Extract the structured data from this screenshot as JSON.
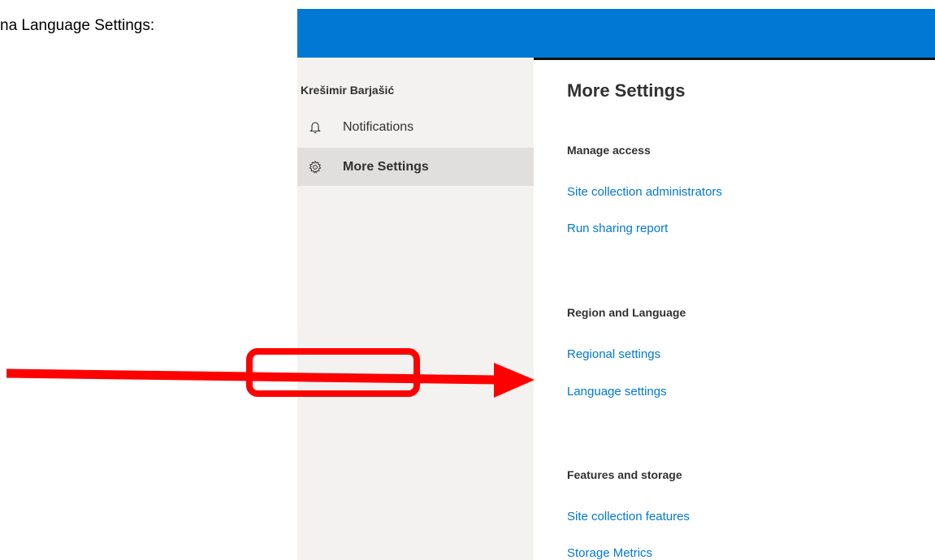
{
  "caption": "na Language Settings:",
  "sidebar": {
    "user_name": "Krešimir Barjašić",
    "items": [
      {
        "label": "Notifications",
        "icon": "bell-icon",
        "selected": false
      },
      {
        "label": "More Settings",
        "icon": "gear-icon",
        "selected": true
      }
    ]
  },
  "main": {
    "title": "More Settings",
    "sections": [
      {
        "heading": "Manage access",
        "links": [
          "Site collection administrators",
          "Run sharing report"
        ]
      },
      {
        "heading": "Region and Language",
        "links": [
          "Regional settings",
          "Language settings"
        ]
      },
      {
        "heading": "Features and storage",
        "links": [
          "Site collection features",
          "Storage Metrics"
        ]
      }
    ]
  },
  "annotation": {
    "highlighted_link": "Language settings",
    "color": "#ff0000"
  },
  "colors": {
    "header": "#0078d4",
    "link": "#0078d4",
    "sidebar_bg": "#f3f2f1",
    "sidebar_selected": "#e1dfdd"
  }
}
